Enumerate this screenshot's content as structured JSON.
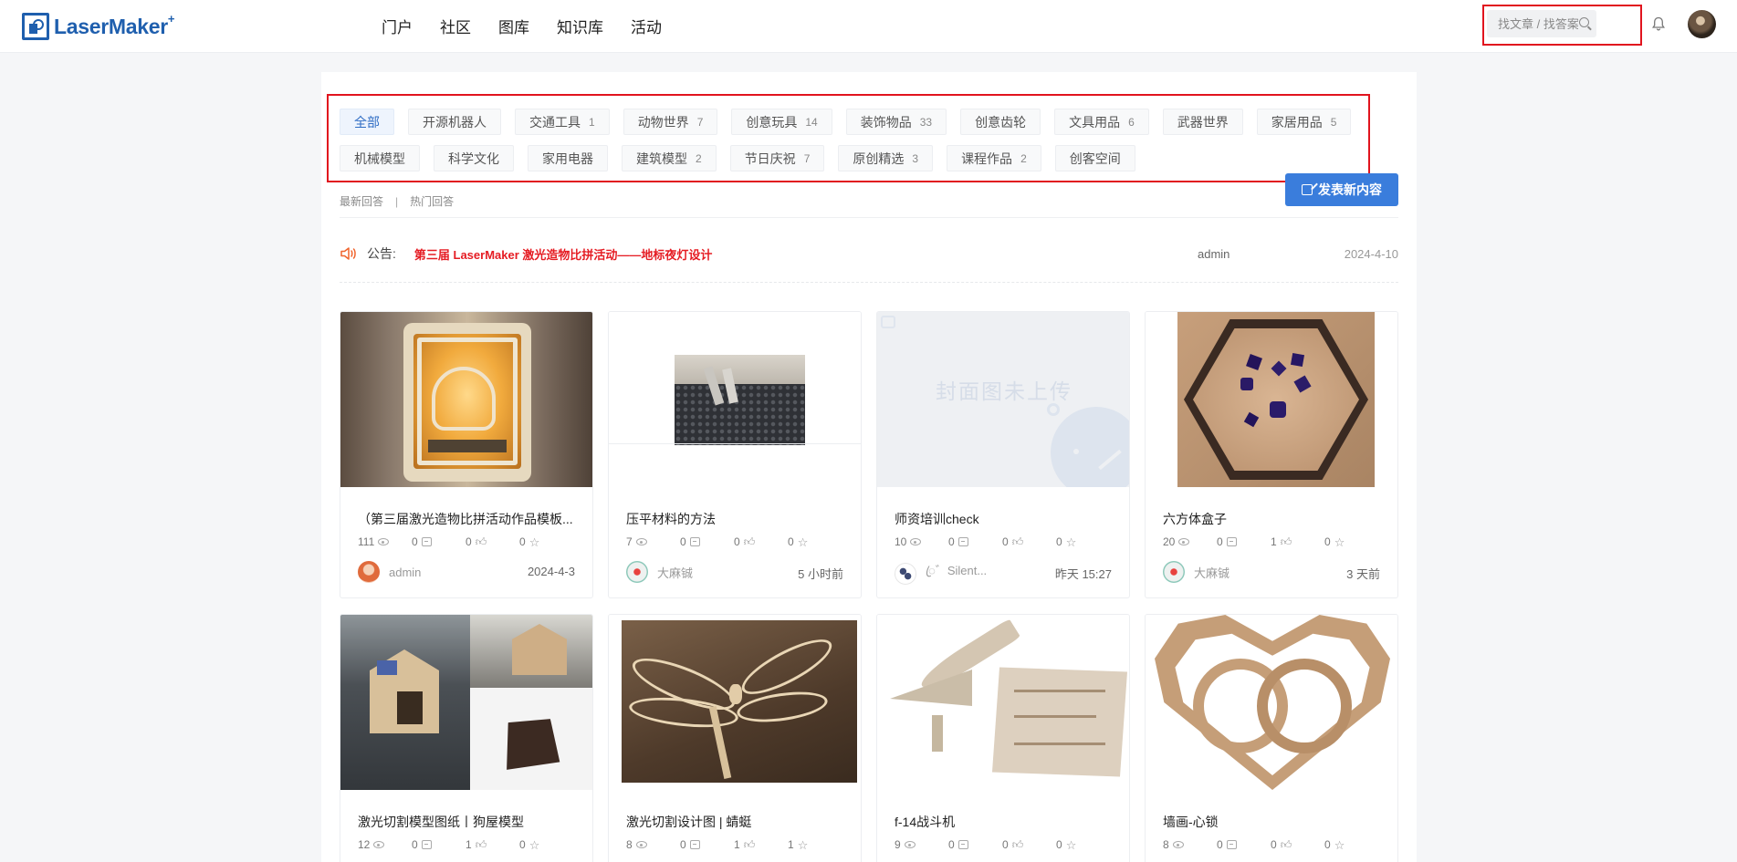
{
  "header": {
    "logo_text": "LaserMaker",
    "logo_plus": "+",
    "nav": [
      "门户",
      "社区",
      "图库",
      "知识库",
      "活动"
    ],
    "search_placeholder": "找文章 / 找答案"
  },
  "categories": {
    "row1": [
      {
        "label": "全部",
        "count": "",
        "active": true
      },
      {
        "label": "开源机器人",
        "count": ""
      },
      {
        "label": "交通工具",
        "count": "1"
      },
      {
        "label": "动物世界",
        "count": "7"
      },
      {
        "label": "创意玩具",
        "count": "14"
      },
      {
        "label": "装饰物品",
        "count": "33"
      },
      {
        "label": "创意齿轮",
        "count": ""
      },
      {
        "label": "文具用品",
        "count": "6"
      },
      {
        "label": "武器世界",
        "count": ""
      },
      {
        "label": "家居用品",
        "count": "5"
      }
    ],
    "row2": [
      {
        "label": "机械模型",
        "count": ""
      },
      {
        "label": "科学文化",
        "count": ""
      },
      {
        "label": "家用电器",
        "count": ""
      },
      {
        "label": "建筑模型",
        "count": "2"
      },
      {
        "label": "节日庆祝",
        "count": "7"
      },
      {
        "label": "原创精选",
        "count": "3"
      },
      {
        "label": "课程作品",
        "count": "2"
      },
      {
        "label": "创客空间",
        "count": ""
      }
    ]
  },
  "tabs": {
    "latest": "最新回答",
    "separator": "|",
    "hot": "热门回答"
  },
  "post_button": "发表新内容",
  "notice": {
    "label": "公告:",
    "text": "第三届 LaserMaker 激光造物比拼活动——地标夜灯设计",
    "author": "admin",
    "date": "2024-4-10"
  },
  "placeholder_cover_text": "封面图未上传",
  "cards": [
    {
      "title": "（第三届激光造物比拼活动作品模板...",
      "views": "111",
      "comments": "0",
      "likes": "0",
      "stars": "0",
      "author": "admin",
      "time": "2024-4-3"
    },
    {
      "title": "压平材料的方法",
      "views": "7",
      "comments": "0",
      "likes": "0",
      "stars": "0",
      "author": "大麻铖",
      "time": "5 小时前"
    },
    {
      "title": "师资培训check",
      "views": "10",
      "comments": "0",
      "likes": "0",
      "stars": "0",
      "author": "ꦿ゛Silent...",
      "time": "昨天 15:27"
    },
    {
      "title": "六方体盒子",
      "views": "20",
      "comments": "0",
      "likes": "1",
      "stars": "0",
      "author": "大麻铖",
      "time": "3 天前"
    },
    {
      "title": "激光切割模型图纸丨狗屋模型",
      "views": "12",
      "comments": "0",
      "likes": "1",
      "stars": "0",
      "author": "",
      "time": ""
    },
    {
      "title": "激光切割设计图 | 蜻蜓",
      "views": "8",
      "comments": "0",
      "likes": "1",
      "stars": "1",
      "author": "",
      "time": ""
    },
    {
      "title": "f-14战斗机",
      "views": "9",
      "comments": "0",
      "likes": "0",
      "stars": "0",
      "author": "",
      "time": ""
    },
    {
      "title": "墙画-心锁",
      "views": "8",
      "comments": "0",
      "likes": "0",
      "stars": "0",
      "author": "",
      "time": ""
    }
  ],
  "colors": {
    "brand": "#1f5fae",
    "accent": "#3a7ddc",
    "notice_red": "#e51c23",
    "highlight_box": "#e1141e"
  }
}
